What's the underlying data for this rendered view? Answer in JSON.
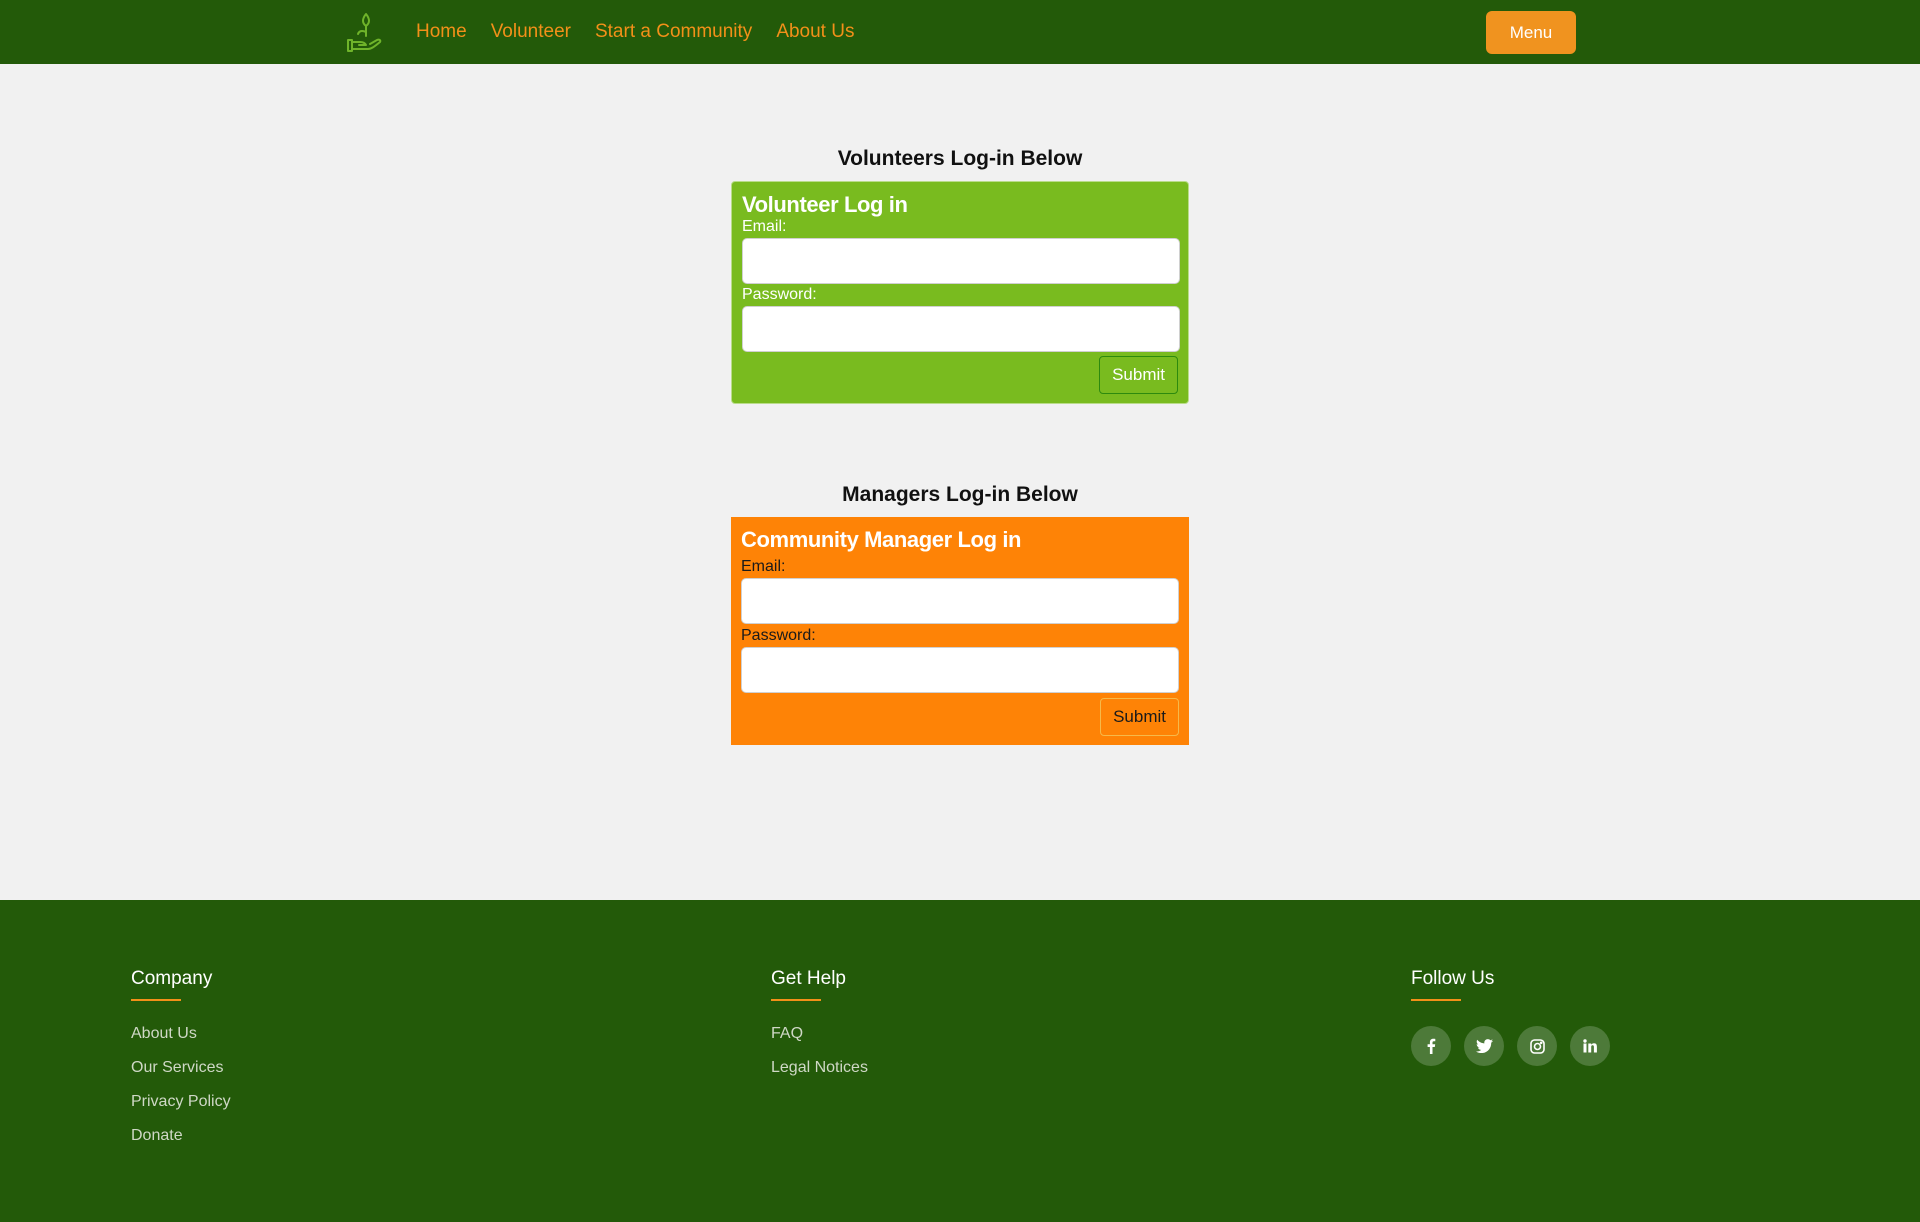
{
  "navbar": {
    "logo_icon": "hand-holding-plant-icon",
    "links": [
      {
        "label": "Home"
      },
      {
        "label": "Volunteer"
      },
      {
        "label": "Start a Community"
      },
      {
        "label": "About Us"
      }
    ],
    "menu_label": "Menu"
  },
  "volunteer_section": {
    "heading": "Volunteers Log-in Below",
    "title": "Volunteer Log in",
    "email_label": "Email:",
    "email_value": "",
    "password_label": "Password:",
    "password_value": "",
    "submit_label": "Submit"
  },
  "manager_section": {
    "heading": "Managers Log-in Below",
    "title": "Community Manager Log in",
    "email_label": "Email:",
    "email_value": "",
    "password_label": "Password:",
    "password_value": "",
    "submit_label": "Submit"
  },
  "footer": {
    "company": {
      "heading": "Company",
      "links": [
        "About Us",
        "Our Services",
        "Privacy Policy",
        "Donate"
      ]
    },
    "help": {
      "heading": "Get Help",
      "links": [
        "FAQ",
        "Legal Notices"
      ]
    },
    "follow": {
      "heading": "Follow Us",
      "icons": [
        "facebook-icon",
        "twitter-icon",
        "instagram-icon",
        "linkedin-icon"
      ]
    }
  },
  "colors": {
    "brand_dark_green": "#235a09",
    "accent_orange": "#f29019",
    "volunteer_panel": "#79bb1f",
    "manager_panel": "#fe8306"
  }
}
